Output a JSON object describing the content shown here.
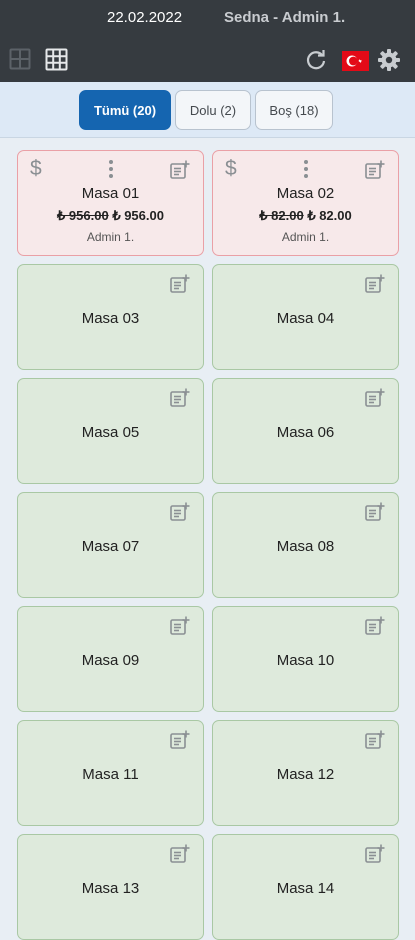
{
  "header": {
    "date": "22.02.2022",
    "user": "Sedna - Admin 1."
  },
  "toolbar": {
    "icons": [
      "grid-2x2-icon",
      "grid-3x3-icon",
      "refresh-icon",
      "turkey-flag-icon",
      "gear-icon"
    ],
    "flag_color": "#e30a17"
  },
  "filters": [
    {
      "label": "Tümü (20)",
      "active": true
    },
    {
      "label": "Dolu (2)",
      "active": false
    },
    {
      "label": "Boş (18)",
      "active": false
    }
  ],
  "colors": {
    "header_bg": "#363b40",
    "active_filter": "#1565b0",
    "busy_card": "#f7e9ea",
    "free_card": "#deeadc"
  },
  "tables": [
    {
      "name": "Masa 01",
      "status": "busy",
      "old_amount": "₺ 956.00",
      "amount": "₺ 956.00",
      "waiter": "Admin 1."
    },
    {
      "name": "Masa 02",
      "status": "busy",
      "old_amount": "₺ 82.00",
      "amount": "₺ 82.00",
      "waiter": "Admin 1."
    },
    {
      "name": "Masa 03",
      "status": "free"
    },
    {
      "name": "Masa 04",
      "status": "free"
    },
    {
      "name": "Masa 05",
      "status": "free"
    },
    {
      "name": "Masa 06",
      "status": "free"
    },
    {
      "name": "Masa 07",
      "status": "free"
    },
    {
      "name": "Masa 08",
      "status": "free"
    },
    {
      "name": "Masa 09",
      "status": "free"
    },
    {
      "name": "Masa 10",
      "status": "free"
    },
    {
      "name": "Masa 11",
      "status": "free"
    },
    {
      "name": "Masa 12",
      "status": "free"
    },
    {
      "name": "Masa 13",
      "status": "free"
    },
    {
      "name": "Masa 14",
      "status": "free"
    }
  ]
}
